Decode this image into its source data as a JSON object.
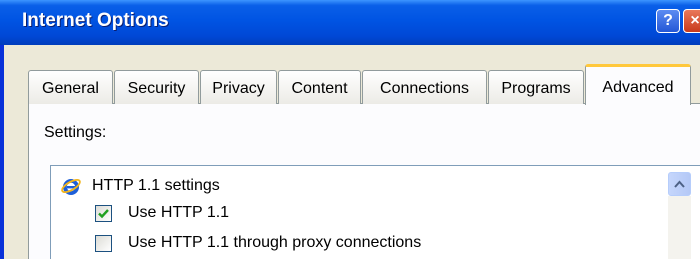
{
  "window": {
    "title": "Internet Options",
    "help_glyph": "?",
    "close_glyph": "×"
  },
  "tabs": [
    {
      "label": "General"
    },
    {
      "label": "Security"
    },
    {
      "label": "Privacy"
    },
    {
      "label": "Content"
    },
    {
      "label": "Connections"
    },
    {
      "label": "Programs"
    },
    {
      "label": "Advanced",
      "active": true
    }
  ],
  "panel": {
    "settings_label": "Settings:",
    "list": {
      "group": {
        "label": "HTTP 1.1 settings",
        "icon": "ie-icon"
      },
      "items": [
        {
          "label": "Use HTTP 1.1",
          "checked": true
        },
        {
          "label": "Use HTTP 1.1 through proxy connections",
          "checked": false
        }
      ]
    }
  },
  "colors": {
    "titlebar": "#0054e3",
    "active_tab_accent": "#ffc83c",
    "check_mark": "#21a121"
  }
}
